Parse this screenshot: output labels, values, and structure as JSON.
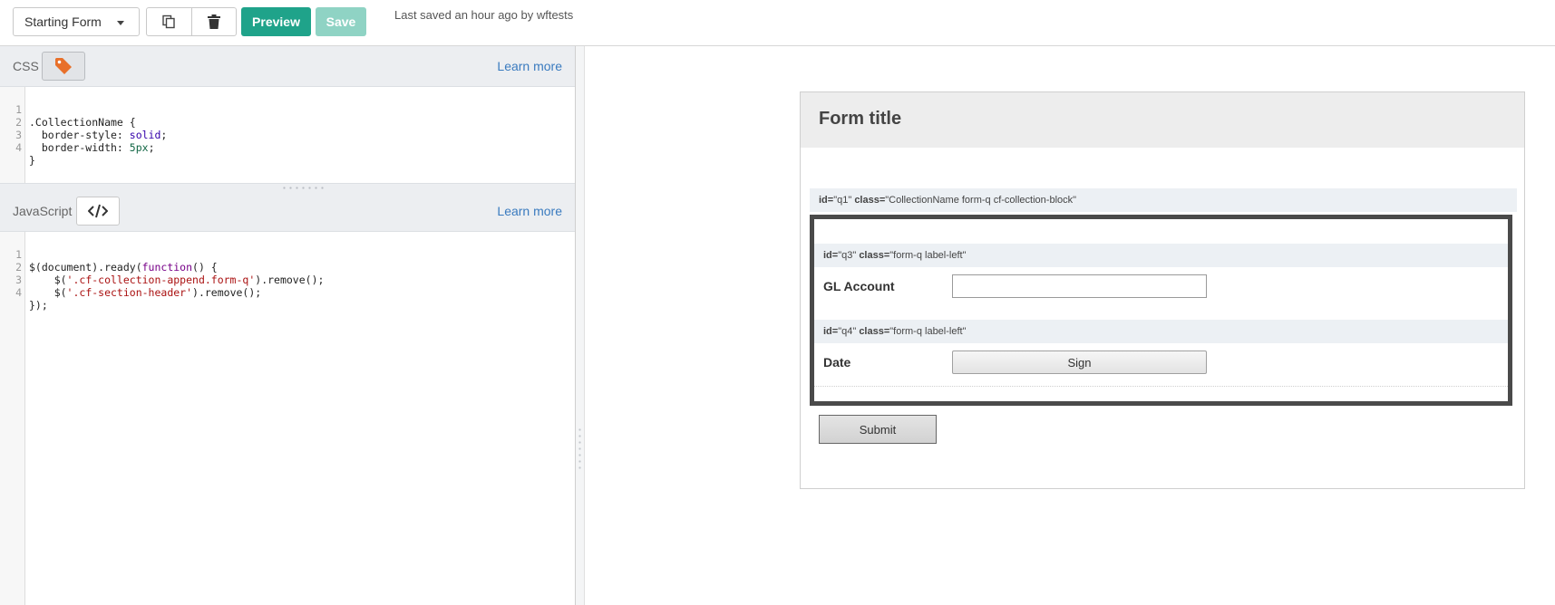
{
  "toolbar": {
    "form_selector": "Starting Form",
    "copy_icon": "copy-icon",
    "delete_icon": "trash-icon",
    "preview_label": "Preview",
    "save_label": "Save",
    "saved_status": "Last saved an hour ago by wftests",
    "colors": {
      "preview": "#1fa38a",
      "save_disabled": "#8fd3c4"
    }
  },
  "css_panel": {
    "label": "CSS",
    "icon": "tag-icon",
    "icon_color": "#e8702a",
    "learn_more": "Learn more",
    "lines": [
      {
        "n": "1",
        "code": ".CollectionName {"
      },
      {
        "n": "2",
        "prop": "  border-style: ",
        "val": "solid",
        "end": ";"
      },
      {
        "n": "3",
        "prop": "  border-width: ",
        "num": "5px",
        "end": ";"
      },
      {
        "n": "4",
        "code": "}"
      }
    ]
  },
  "js_panel": {
    "label": "JavaScript",
    "icon": "code-icon",
    "learn_more": "Learn more",
    "lines": [
      {
        "n": "1",
        "a": "$(document).ready(",
        "kw": "function",
        "b": "() {"
      },
      {
        "n": "2",
        "a": "    $(",
        "str": "'.cf-collection-append.form-q'",
        "b": ").remove();"
      },
      {
        "n": "3",
        "a": "    $(",
        "str": "'.cf-section-header'",
        "b": ").remove();"
      },
      {
        "n": "4",
        "a": "});"
      }
    ]
  },
  "preview": {
    "form_title": "Form title",
    "q1": {
      "id_key": "id=",
      "id_val": "\"q1\"",
      "class_key": "class=",
      "class_val": "\"CollectionName form-q cf-collection-block\""
    },
    "q3": {
      "id_key": "id=",
      "id_val": "\"q3\"",
      "class_key": "class=",
      "class_val": "\"form-q label-left\"",
      "label": "GL Account",
      "value": ""
    },
    "q4": {
      "id_key": "id=",
      "id_val": "\"q4\"",
      "class_key": "class=",
      "class_val": "\"form-q label-left\"",
      "label": "Date",
      "button": "Sign"
    },
    "submit": "Submit"
  }
}
